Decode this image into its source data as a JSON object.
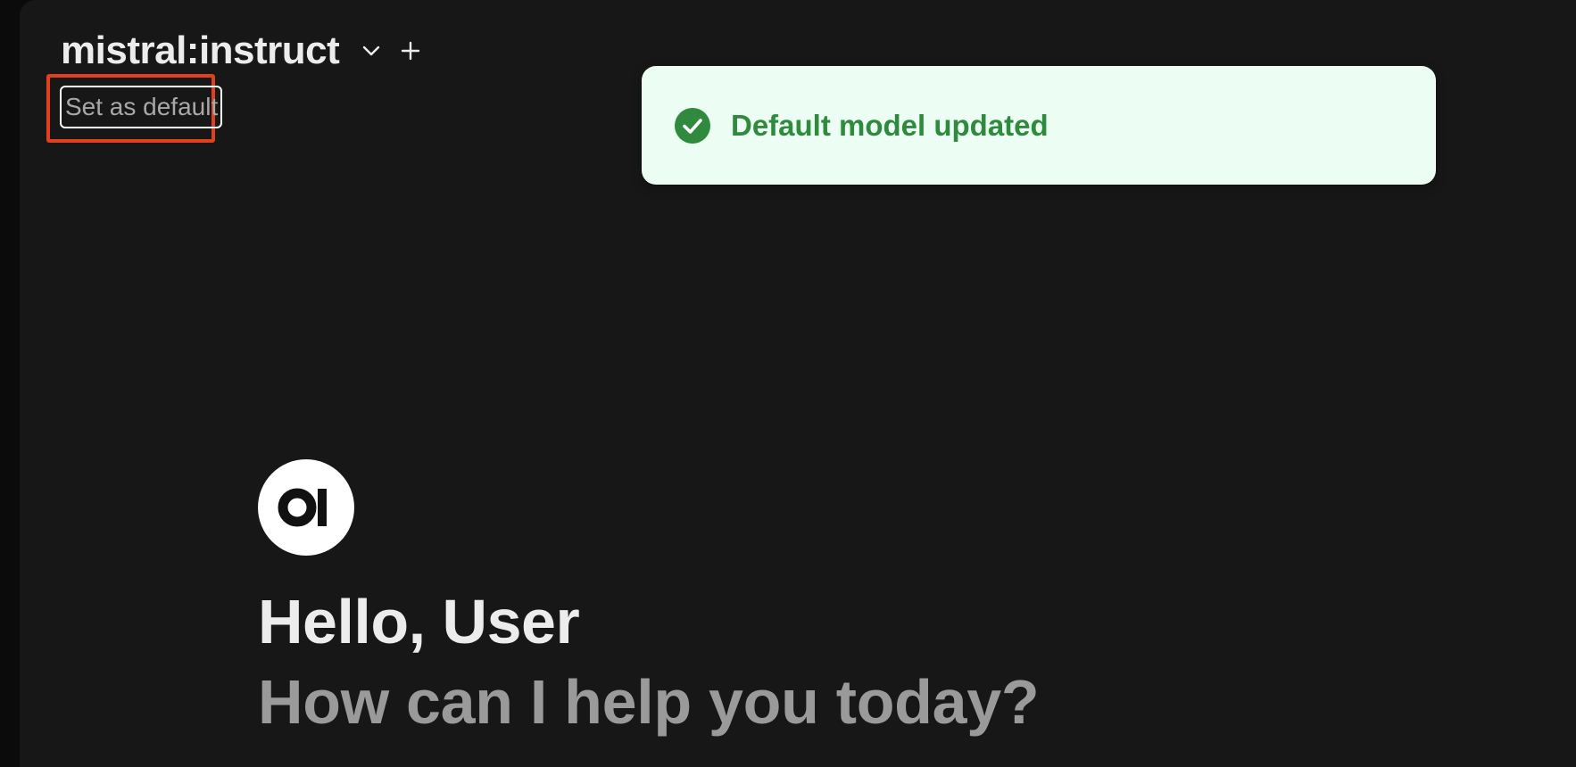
{
  "header": {
    "model_name": "mistral:instruct",
    "dropdown_icon": "chevron-down-icon",
    "add_icon": "plus-icon",
    "set_default_label": "Set as default"
  },
  "toast": {
    "icon": "check-circle-icon",
    "message": "Default model updated",
    "colors": {
      "background": "#ecfdf3",
      "accent": "#2f8a3e"
    }
  },
  "welcome": {
    "logo_text": "OI",
    "greeting": "Hello, User",
    "subtitle": "How can I help you today?"
  },
  "colors": {
    "background": "#171717",
    "highlight": "#e0401e"
  }
}
